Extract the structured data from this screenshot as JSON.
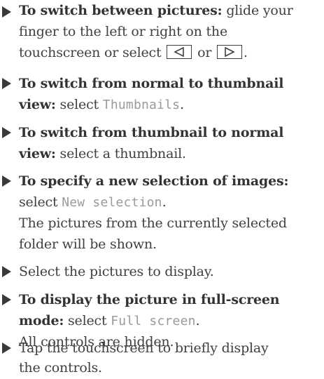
{
  "items": [
    {
      "bold": "To switch between pictures:",
      "text": " glide your",
      "line2": "finger to the left or right on the",
      "line3_pre": "touchscreen or select ",
      "line3_mid": " or ",
      "line3_post": ".",
      "left_icon": "triangle-left-icon",
      "right_icon": "triangle-right-icon"
    },
    {
      "bold1": "To switch from normal to thumbnail",
      "bold2": "view:",
      "text": " select ",
      "ui": "Thumbnails",
      "post": "."
    },
    {
      "bold1": "To switch from thumbnail to normal",
      "bold2": "view:",
      "text": " select a thumbnail."
    },
    {
      "bold": "To specify a new selection of images:",
      "pre": "select ",
      "ui": "New selection",
      "post": ".",
      "line3": "The pictures from the currently selected",
      "line4": "folder will be shown."
    },
    {
      "text": "Select the pictures to display."
    },
    {
      "bold1": "To display the picture in full-screen",
      "bold2": "mode:",
      "text": " select ",
      "ui": "Full screen",
      "post": ".",
      "line3": "All controls are hidden."
    },
    {
      "text1": "Tap the touchscreen to briefly display",
      "text2": "the controls."
    }
  ]
}
